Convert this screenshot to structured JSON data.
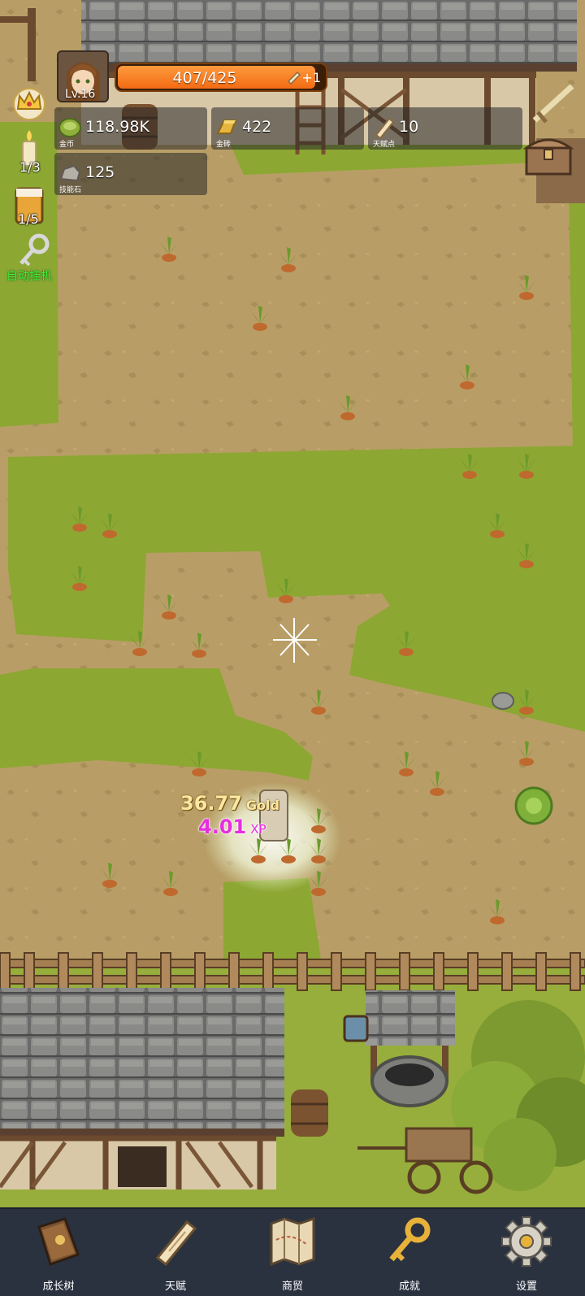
{
  "player": {
    "level_label": "Lv.16",
    "xp_current": 407,
    "xp_max": 425,
    "xp_text": "407/425",
    "xp_bonus": "+1"
  },
  "resources": {
    "gold": {
      "value": "118.98K",
      "caption": "金币",
      "icon": "gold-coin-icon"
    },
    "gold_bar": {
      "value": "422",
      "caption": "金砖",
      "icon": "gold-bar-icon"
    },
    "talent_points": {
      "value": "10",
      "caption": "天赋点",
      "icon": "scroll-icon"
    },
    "skill_stone": {
      "value": "125",
      "caption": "技能石",
      "icon": "stone-icon"
    }
  },
  "side_items": {
    "candle_count": "1/3",
    "beer_count": "1/5",
    "auto_label": "自动挂机"
  },
  "floating": {
    "gold_amount": "36.77",
    "gold_unit": "Gold",
    "xp_amount": "4.01",
    "xp_unit": "XP"
  },
  "nav": [
    {
      "label": "成长树",
      "icon": "book-icon"
    },
    {
      "label": "天赋",
      "icon": "scroll-icon"
    },
    {
      "label": "商贸",
      "icon": "map-icon"
    },
    {
      "label": "成就",
      "icon": "key-icon"
    },
    {
      "label": "设置",
      "icon": "gear-icon"
    }
  ],
  "colors": {
    "dirt": "#b89e66",
    "grass": "#8da733",
    "xp_bar": "#f26b14",
    "nav_bg": "#2a3240",
    "auto_label": "#3cf03c"
  }
}
